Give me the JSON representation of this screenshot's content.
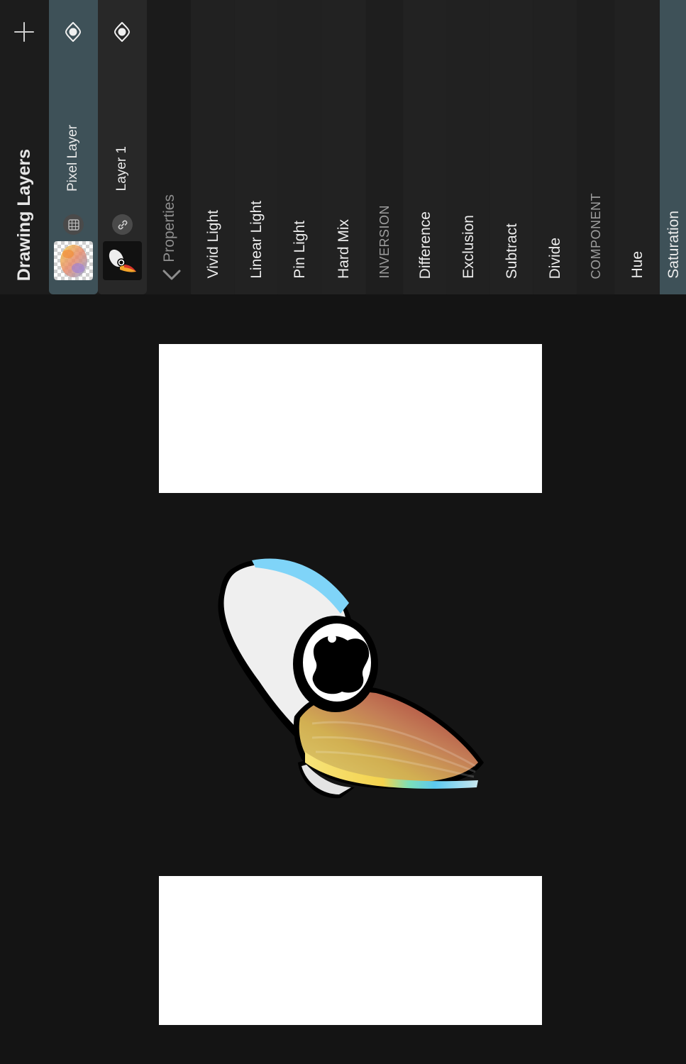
{
  "panel": {
    "title": "Drawing Layers",
    "add_icon": "plus-icon"
  },
  "layers": [
    {
      "name": "Pixel Layer",
      "badge_icon": "grid-icon",
      "visibility_icon": "eye-icon",
      "selected": true
    },
    {
      "name": "Layer 1",
      "badge_icon": "link-icon",
      "visibility_icon": "eye-icon",
      "selected": false
    }
  ],
  "properties": {
    "label": "Properties",
    "back_icon": "chevron-down-icon"
  },
  "blend_modes": [
    {
      "label": "Vivid Light",
      "type": "item"
    },
    {
      "label": "Linear Light",
      "type": "item"
    },
    {
      "label": "Pin Light",
      "type": "item"
    },
    {
      "label": "Hard Mix",
      "type": "item"
    },
    {
      "label": "INVERSION",
      "type": "section"
    },
    {
      "label": "Difference",
      "type": "item"
    },
    {
      "label": "Exclusion",
      "type": "item"
    },
    {
      "label": "Subtract",
      "type": "item"
    },
    {
      "label": "Divide",
      "type": "item"
    },
    {
      "label": "COMPONENT",
      "type": "section"
    },
    {
      "label": "Hue",
      "type": "item"
    },
    {
      "label": "Saturation",
      "type": "item",
      "selected": true
    }
  ],
  "colors": {
    "selection": "#3e5158",
    "background": "#151515",
    "canvas_white": "#ffffff"
  }
}
